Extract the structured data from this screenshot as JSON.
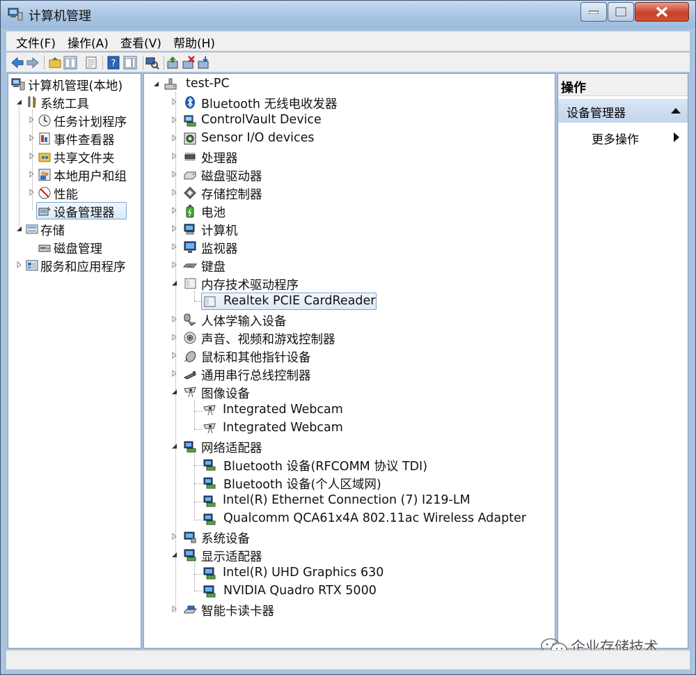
{
  "window": {
    "title": "计算机管理"
  },
  "menu": [
    "文件(F)",
    "操作(A)",
    "查看(V)",
    "帮助(H)"
  ],
  "left_tree": {
    "root": "计算机管理(本地)",
    "system_tools": "系统工具",
    "task_scheduler": "任务计划程序",
    "event_viewer": "事件查看器",
    "shared_folders": "共享文件夹",
    "local_users": "本地用户和组",
    "performance": "性能",
    "device_manager": "设备管理器",
    "storage": "存储",
    "disk_management": "磁盘管理",
    "services_apps": "服务和应用程序"
  },
  "device_tree": {
    "root": "test-PC",
    "categories": [
      "Bluetooth 无线电收发器",
      "ControlVault Device",
      "Sensor I/O devices",
      "处理器",
      "磁盘驱动器",
      "存储控制器",
      "电池",
      "计算机",
      "监视器",
      "键盘",
      "内存技术驱动程序",
      "人体学输入设备",
      "声音、视频和游戏控制器",
      "鼠标和其他指针设备",
      "通用串行总线控制器",
      "图像设备",
      "网络适配器",
      "系统设备",
      "显示适配器",
      "智能卡读卡器"
    ],
    "memory_children": [
      "Realtek PCIE CardReader"
    ],
    "imaging_children": [
      "Integrated Webcam",
      "Integrated Webcam"
    ],
    "network_children": [
      "Bluetooth 设备(RFCOMM 协议 TDI)",
      "Bluetooth 设备(个人区域网)",
      "Intel(R) Ethernet Connection (7) I219-LM",
      "Qualcomm QCA61x4A 802.11ac Wireless Adapter"
    ],
    "display_children": [
      "Intel(R) UHD Graphics 630",
      "NVIDIA Quadro RTX 5000"
    ]
  },
  "actions": {
    "header": "操作",
    "section": "设备管理器",
    "more": "更多操作"
  },
  "watermark": "企业存储技术",
  "colors": {
    "accent": "#a9c3e0",
    "selection": "#dce9f9",
    "close": "#c74128"
  }
}
